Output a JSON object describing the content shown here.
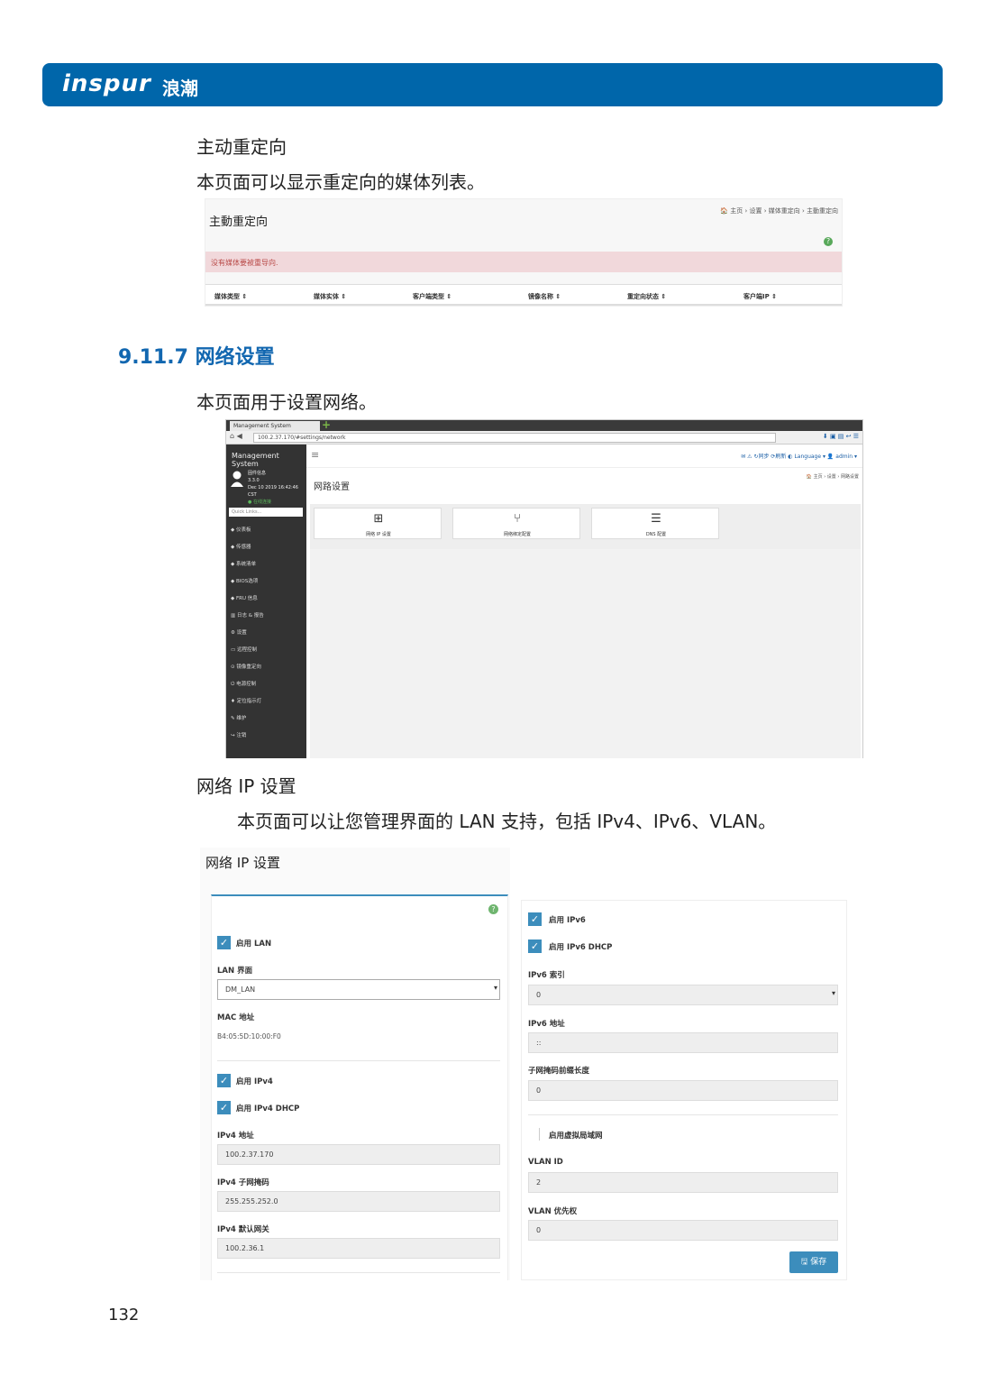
{
  "header": {
    "logo_text": "inspur",
    "logo_cn": "浪潮",
    "brand_color": "#0066aa"
  },
  "intro": {
    "heading": "主动重定向",
    "desc": "本页面可以显示重定向的媒体列表。"
  },
  "redirect_shot": {
    "title": "主動重定向",
    "breadcrumb": "🏠 主页 › 设置 › 媒体重定向 › 主動重定向",
    "alert": "没有媒体要被重导向.",
    "columns": [
      "媒体类型 ⇕",
      "媒体实体 ⇕",
      "客户端类型 ⇕",
      "镜像名称 ⇕",
      "重定向状态 ⇕",
      "客户端IP ⇕"
    ]
  },
  "section": {
    "heading": "9.11.7 网络设置",
    "desc": "本页面用于设置网络。"
  },
  "browser_shot": {
    "tab_title": "Management System",
    "url": "100.2.37.170/#settings/network",
    "app_title": "Management System",
    "user": [
      "固件信息",
      "3.3.0",
      "Dec 10 2019 16:42:46 CST",
      "● 在线连接"
    ],
    "quick_links": "Quick Links...",
    "sidebar": [
      "仪表板",
      "传感器",
      "系统清单",
      "BIOS选项",
      "FRU 信息",
      "日志 & 报告",
      "设置",
      "远程控制",
      "镜像重定向",
      "电源控制",
      "定位指示灯",
      "维护",
      "注销"
    ],
    "top_right": "✉  ⚠  ↻同步  ⟳刷新  ◐ Language ▾   👤 admin ▾",
    "page_title": "网路设置",
    "breadcrumb": "🏠 主页 › 设置 › 网路设置",
    "tiles": [
      {
        "icon": "⊞",
        "label": "网络 IP 设置"
      },
      {
        "icon": "⑂",
        "label": "网络绑定配置"
      },
      {
        "icon": "☰",
        "label": "DNS 配置"
      }
    ]
  },
  "ip_section": {
    "heading": "网络 IP 设置",
    "desc": "本页面可以让您管理界面的 LAN 支持，包括 IPv4、IPv6、VLAN。"
  },
  "ip_shot": {
    "title": "网络 IP 设置",
    "enable_lan": "启用 LAN",
    "lan_iface_label": "LAN 界面",
    "lan_iface_value": "DM_LAN",
    "mac_label": "MAC 地址",
    "mac_value": "B4:05:5D:10:00:F0",
    "enable_ipv4": "启用 IPv4",
    "enable_ipv4_dhcp": "启用 IPv4 DHCP",
    "ipv4_addr_label": "IPv4 地址",
    "ipv4_addr_value": "100.2.37.170",
    "ipv4_mask_label": "IPv4 子网掩码",
    "ipv4_mask_value": "255.255.252.0",
    "ipv4_gw_label": "IPv4 默认网关",
    "ipv4_gw_value": "100.2.36.1",
    "enable_ipv6": "启用 IPv6",
    "enable_ipv6_dhcp": "启用 IPv6 DHCP",
    "ipv6_index_label": "IPv6 索引",
    "ipv6_index_value": "0",
    "ipv6_addr_label": "IPv6 地址",
    "ipv6_addr_value": "::",
    "prefix_label": "子网掩码前缀长度",
    "prefix_value": "0",
    "enable_vlan": "启用虚拟局域网",
    "vlan_id_label": "VLAN ID",
    "vlan_id_value": "2",
    "vlan_pri_label": "VLAN 优先权",
    "vlan_pri_value": "0",
    "save": "🖫 保存"
  },
  "page_number": "132"
}
